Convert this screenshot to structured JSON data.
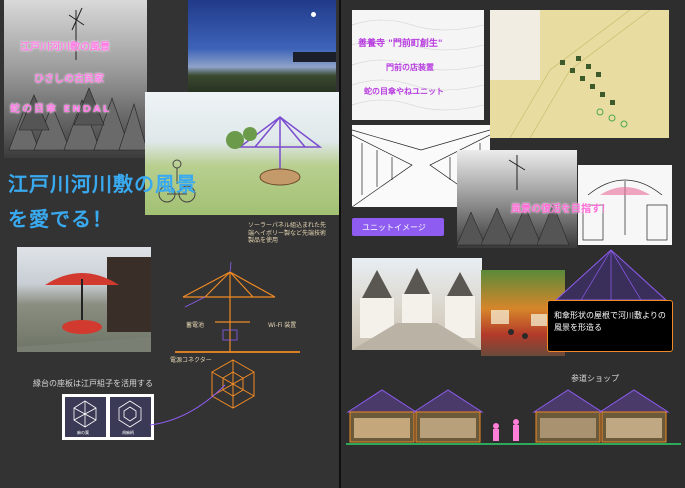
{
  "left": {
    "collage_caption_1": "江戸川河川敷の風景",
    "collage_caption_2": "ひさしの古民家",
    "collage_caption_3": "蛇の目傘 ENDAL",
    "headline_1": "江戸川河川敷の風景",
    "headline_2": "を愛でる！",
    "diagram_notes": {
      "solar": "ソーラーパネル組込まれた先端へイボリー製など先端技術製品を使用",
      "light": "蓄電池",
      "wifi": "Wi-Fi 装置",
      "connector": "電源コネクター"
    },
    "bench_caption": "縁台の座板は江戸組子を活用する",
    "pattern_labels": [
      "麻の葉",
      "胡麻柄"
    ]
  },
  "right": {
    "vision_lines": [
      "善養寺 \"門前町創生\"",
      "門前の店装置",
      "蛇の目傘やねユニット"
    ],
    "unit_button": "ユニットイメージ",
    "revival_caption": "風景の復活を目指す！",
    "roof_caption": "和傘形状の屋根で河川敷よりの風景を形造る",
    "shop_label": "参道ショップ"
  },
  "colors": {
    "accent_purple": "#8e5cf0",
    "accent_orange": "#f08a24",
    "pink_text": "#ff7ee6",
    "headline_blue": "#39a9f0",
    "ground_green": "#2ea85a"
  }
}
